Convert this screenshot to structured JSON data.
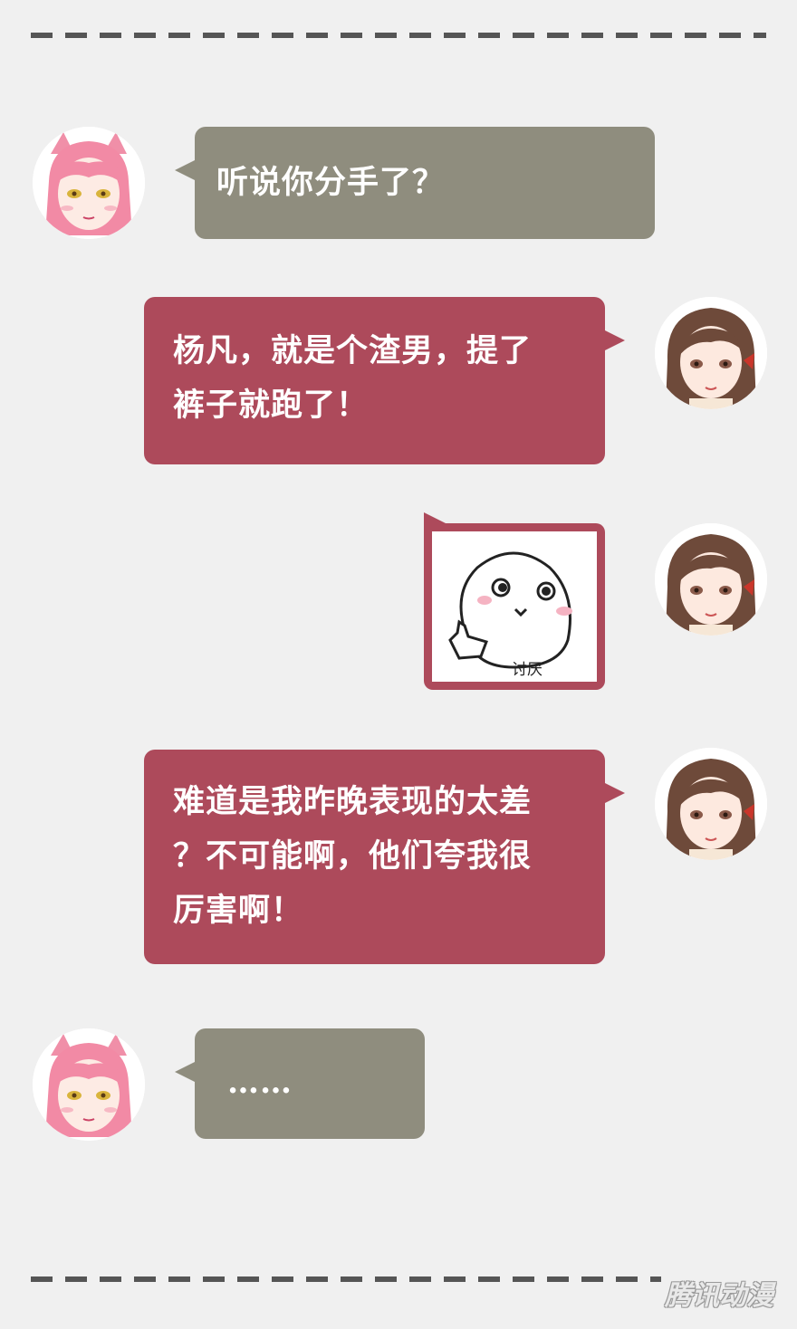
{
  "colors": {
    "background": "#f0f0f0",
    "left_bubble": "#8f8d7e",
    "right_bubble": "#ad4a5b",
    "divider": "#555555"
  },
  "messages": [
    {
      "sender": "pink-hair-girl",
      "side": "left",
      "text": "听说你分手了？"
    },
    {
      "sender": "brown-hair-girl",
      "side": "right",
      "text": "杨凡，就是个渣男，提了\n裤子就跑了！"
    },
    {
      "sender": "brown-hair-girl",
      "side": "right",
      "type": "sticker",
      "sticker_icon": "white-blob-pointing-sticker",
      "caption": "讨厌"
    },
    {
      "sender": "brown-hair-girl",
      "side": "right",
      "text": "难道是我昨晚表现的太差\n？不可能啊，他们夸我很\n厉害啊！"
    },
    {
      "sender": "pink-hair-girl",
      "side": "left",
      "text": "……"
    }
  ],
  "watermark": "腾讯动漫"
}
